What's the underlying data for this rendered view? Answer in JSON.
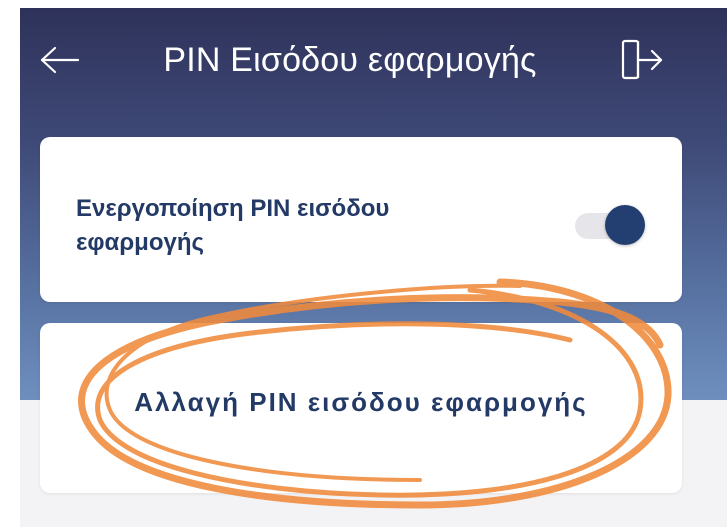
{
  "header": {
    "title": "PIN Εισόδου εφαρμογής",
    "back_icon": "arrow-left-icon",
    "exit_icon": "logout-door-icon"
  },
  "settings": {
    "pin_toggle": {
      "label": "Ενεργοποίηση PIN εισόδου εφαρμογής",
      "enabled": true
    },
    "change_pin": {
      "label": "Αλλαγή PIN εισόδου εφαρμογής"
    }
  },
  "colors": {
    "header_top": "#2e325a",
    "header_bottom": "#6e8fbe",
    "primary_text": "#233a66",
    "toggle_on": "#233f72",
    "annotation": "#f08a3c"
  }
}
